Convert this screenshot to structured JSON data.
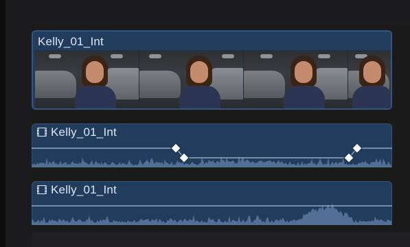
{
  "timeline": {
    "clips": [
      {
        "id": "video",
        "name": "Kelly_01_Int",
        "kind": "video"
      },
      {
        "id": "audio1",
        "name": "Kelly_01_Int",
        "kind": "audio",
        "icon": "film-icon",
        "keyframes": 4
      },
      {
        "id": "audio2",
        "name": "Kelly_01_Int",
        "kind": "audio",
        "icon": "film-icon"
      }
    ]
  },
  "colors": {
    "clip_fill": "#223c5e",
    "waveform": "#5f7ea6",
    "keyframe": "#ffffff"
  }
}
